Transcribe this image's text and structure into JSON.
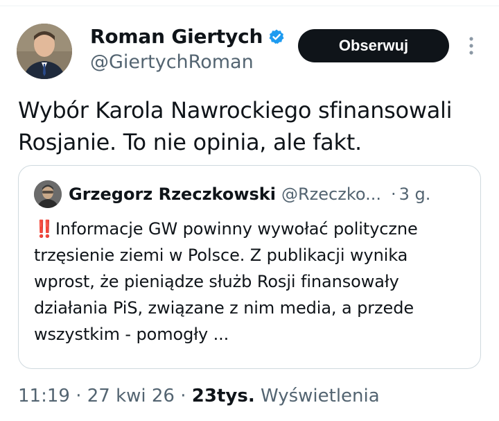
{
  "tweet": {
    "author": {
      "name": "Roman Giertych",
      "handle": "@GiertychRoman",
      "verified": true
    },
    "follow_label": "Obserwuj",
    "text": "Wybór Karola Nawrockiego sfinansowali Rosjanie. To nie opinia, ale fakt.",
    "quoted": {
      "name": "Grzegorz Rzeczkowski",
      "handle": "@Rzeczko...",
      "separator": "·",
      "time": "3 g.",
      "alert": "‼️",
      "text": "Informacje GW powinny wywołać polityczne trzęsienie ziemi w Polsce. Z publikacji wynika wprost, że pieniądze służb Rosji finansowały działania PiS, związane z nim media, a przede wszystkim - pomogły ..."
    },
    "meta": {
      "time": "11:19",
      "separator1": " · ",
      "date": "27 kwi 26",
      "separator2": " · ",
      "views_count": "23tys.",
      "views_label": " Wyświetlenia"
    }
  },
  "colors": {
    "text_primary": "#0f1419",
    "text_secondary": "#536471",
    "verified_blue": "#1d9bf0",
    "follow_bg": "#0f1419",
    "border": "#cfd9de"
  },
  "icons": {
    "verified": "verified-badge-icon",
    "more": "more-vertical-icon",
    "alert": "double-exclamation-icon"
  }
}
